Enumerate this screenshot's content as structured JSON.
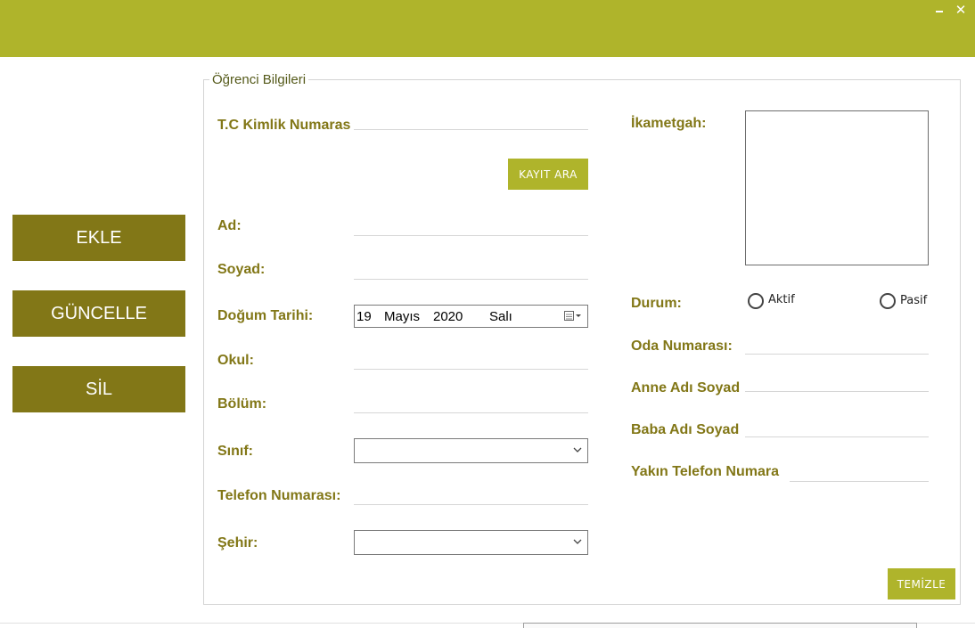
{
  "window": {
    "minimize_label": "_",
    "close_label": "✕"
  },
  "sidebar": {
    "add_label": "EKLE",
    "update_label": "GÜNCELLE",
    "delete_label": "SİL"
  },
  "form": {
    "group_title": "Öğrenci Bilgileri",
    "labels": {
      "tc": "T.C Kimlik Numaras",
      "ad": "Ad:",
      "soyad": "Soyad:",
      "dogum": "Doğum Tarihi:",
      "okul": "Okul:",
      "bolum": "Bölüm:",
      "sinif": "Sınıf:",
      "telefon": "Telefon Numarası:",
      "sehir": "Şehir:",
      "ikametgah": "İkametgah:",
      "durum": "Durum:",
      "oda": "Oda Numarası:",
      "anne": "Anne Adı Soyad",
      "baba": "Baba Adı Soyad",
      "yakin": "Yakın Telefon Numara"
    },
    "buttons": {
      "search": "KAYIT ARA",
      "clear": "TEMİZLE"
    },
    "date": {
      "day": "19",
      "month": "Mayıs",
      "year": "2020",
      "weekday": "Salı"
    },
    "status_options": {
      "active": "Aktif",
      "passive": "Pasif"
    },
    "values": {
      "tc": "",
      "ad": "",
      "soyad": "",
      "okul": "",
      "bolum": "",
      "sinif": "",
      "telefon": "",
      "sehir": "",
      "oda": "",
      "anne": "",
      "baba": "",
      "yakin": "",
      "ikametgah": ""
    }
  },
  "colors": {
    "titlebar": "#afb42b",
    "sidebar_button": "#827717",
    "label_text": "#827717",
    "action_button": "#afb42b"
  }
}
